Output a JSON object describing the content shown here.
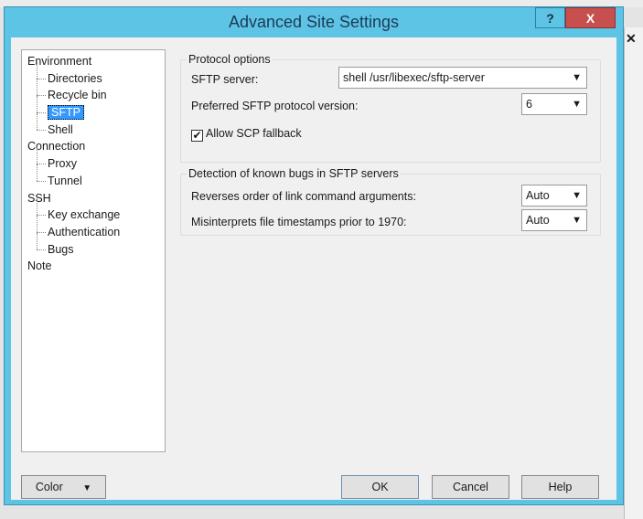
{
  "dialog": {
    "title": "Advanced Site Settings",
    "help_button": "?",
    "close_button": "X"
  },
  "tree": [
    {
      "label": "Environment",
      "level": 0
    },
    {
      "label": "Directories",
      "level": 1
    },
    {
      "label": "Recycle bin",
      "level": 1
    },
    {
      "label": "SFTP",
      "level": 1,
      "selected": true
    },
    {
      "label": "Shell",
      "level": 1
    },
    {
      "label": "Connection",
      "level": 0
    },
    {
      "label": "Proxy",
      "level": 1
    },
    {
      "label": "Tunnel",
      "level": 1
    },
    {
      "label": "SSH",
      "level": 0
    },
    {
      "label": "Key exchange",
      "level": 1
    },
    {
      "label": "Authentication",
      "level": 1
    },
    {
      "label": "Bugs",
      "level": 1
    },
    {
      "label": "Note",
      "level": 0
    }
  ],
  "protocol": {
    "group_label": "Protocol options",
    "server_label": "SFTP server:",
    "server_value": "shell /usr/libexec/sftp-server",
    "version_label": "Preferred SFTP protocol version:",
    "version_value": "6",
    "scp_label": "Allow SCP fallback",
    "scp_checked": true
  },
  "bugs": {
    "group_label": "Detection of known bugs in SFTP servers",
    "reverse_label": "Reverses order of link command arguments:",
    "reverse_value": "Auto",
    "timestamps_label": "Misinterprets file timestamps prior to 1970:",
    "timestamps_value": "Auto"
  },
  "buttons": {
    "color": "Color",
    "ok": "OK",
    "cancel": "Cancel",
    "help": "Help"
  }
}
